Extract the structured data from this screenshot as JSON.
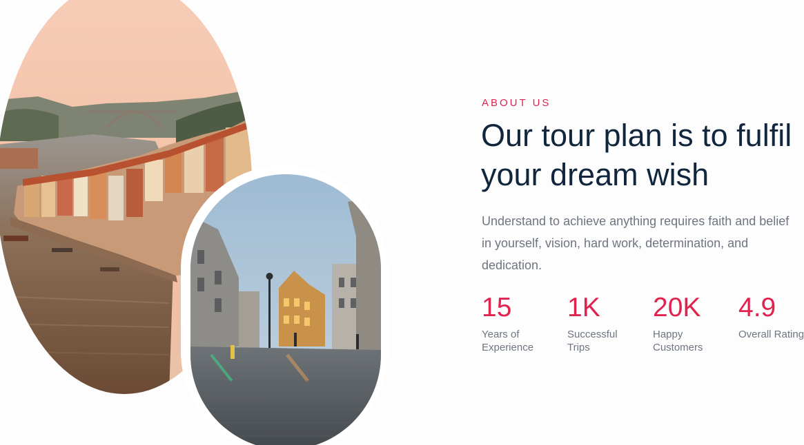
{
  "about": {
    "eyebrow": "ABOUT US",
    "title": "Our tour plan is to fulfil\nyour dream wish",
    "description": "Understand to achieve anything requires faith and belief in yourself, vision, hard work, determination, and dedication."
  },
  "stats": [
    {
      "value": "15",
      "label": "Years of\nExperience"
    },
    {
      "value": "1K",
      "label": "Successful\nTrips"
    },
    {
      "value": "20K",
      "label": "Happy\nCustomers"
    },
    {
      "value": "4.9",
      "label": "Overall Rating"
    }
  ],
  "colors": {
    "accent": "#e0224f",
    "heading": "#11263c",
    "body": "#6e7580",
    "background": "#fdfdfd"
  }
}
